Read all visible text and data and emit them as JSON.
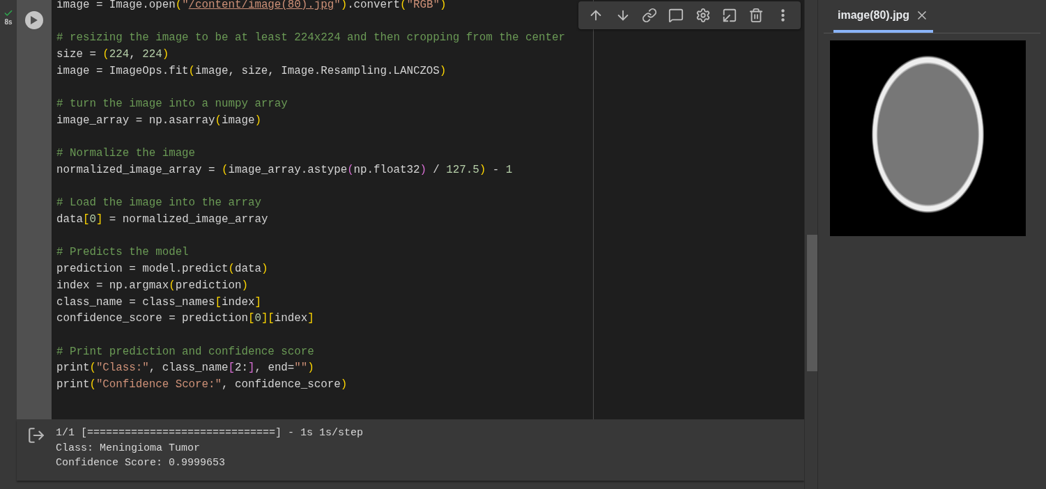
{
  "cell": {
    "status": {
      "done": true,
      "duration": "8s"
    },
    "toolbar": [
      {
        "kind": "up"
      },
      {
        "kind": "down"
      },
      {
        "kind": "link"
      },
      {
        "kind": "comment"
      },
      {
        "kind": "settings"
      },
      {
        "kind": "tab"
      },
      {
        "kind": "delete"
      },
      {
        "kind": "more"
      }
    ],
    "code_blocks": [
      [
        [
          {
            "kind": "plain",
            "text": "image = Image.open"
          },
          {
            "kind": "bracket",
            "text": "("
          },
          {
            "kind": "string",
            "text": "\""
          },
          {
            "kind": "link",
            "text": "/content/image(80).jpg"
          },
          {
            "kind": "string",
            "text": "\""
          },
          {
            "kind": "bracket",
            "text": ")"
          },
          {
            "kind": "plain",
            "text": ".convert"
          },
          {
            "kind": "bracket",
            "text": "("
          },
          {
            "kind": "string",
            "text": "\"RGB\""
          },
          {
            "kind": "bracket",
            "text": ")"
          }
        ]
      ],
      [
        [
          {
            "kind": "comment",
            "text": "# resizing the image to be at least 224x224 and then cropping from the center"
          }
        ],
        [
          {
            "kind": "plain",
            "text": "size = "
          },
          {
            "kind": "bracket",
            "text": "("
          },
          {
            "kind": "number",
            "text": "224"
          },
          {
            "kind": "plain",
            "text": ", "
          },
          {
            "kind": "number",
            "text": "224"
          },
          {
            "kind": "bracket",
            "text": ")"
          }
        ],
        [
          {
            "kind": "plain",
            "text": "image = ImageOps.fit"
          },
          {
            "kind": "bracket",
            "text": "("
          },
          {
            "kind": "plain",
            "text": "image, size, Image.Resampling.LANCZOS"
          },
          {
            "kind": "bracket",
            "text": ")"
          }
        ]
      ],
      [
        [
          {
            "kind": "comment",
            "text": "# turn the image into a numpy array"
          }
        ],
        [
          {
            "kind": "plain",
            "text": "image_array = np.asarray"
          },
          {
            "kind": "bracket",
            "text": "("
          },
          {
            "kind": "plain",
            "text": "image"
          },
          {
            "kind": "bracket",
            "text": ")"
          }
        ]
      ],
      [
        [
          {
            "kind": "comment",
            "text": "# Normalize the image"
          }
        ],
        [
          {
            "kind": "plain",
            "text": "normalized_image_array = "
          },
          {
            "kind": "bracket",
            "text": "("
          },
          {
            "kind": "plain",
            "text": "image_array.astype"
          },
          {
            "kind": "bracket2",
            "text": "("
          },
          {
            "kind": "plain",
            "text": "np.float32"
          },
          {
            "kind": "bracket2",
            "text": ")"
          },
          {
            "kind": "plain",
            "text": " / "
          },
          {
            "kind": "number",
            "text": "127.5"
          },
          {
            "kind": "bracket",
            "text": ")"
          },
          {
            "kind": "plain",
            "text": " - "
          },
          {
            "kind": "number",
            "text": "1"
          }
        ]
      ],
      [
        [
          {
            "kind": "comment",
            "text": "# Load the image into the array"
          }
        ],
        [
          {
            "kind": "plain",
            "text": "data"
          },
          {
            "kind": "bracket",
            "text": "["
          },
          {
            "kind": "number",
            "text": "0"
          },
          {
            "kind": "bracket",
            "text": "]"
          },
          {
            "kind": "plain",
            "text": " = normalized_image_array"
          }
        ]
      ],
      [
        [
          {
            "kind": "comment",
            "text": "# Predicts the model"
          }
        ],
        [
          {
            "kind": "plain",
            "text": "prediction = model.predict"
          },
          {
            "kind": "bracket",
            "text": "("
          },
          {
            "kind": "plain",
            "text": "data"
          },
          {
            "kind": "bracket",
            "text": ")"
          }
        ],
        [
          {
            "kind": "plain",
            "text": "index = np.argmax"
          },
          {
            "kind": "bracket",
            "text": "("
          },
          {
            "kind": "plain",
            "text": "prediction"
          },
          {
            "kind": "bracket",
            "text": ")"
          }
        ],
        [
          {
            "kind": "plain",
            "text": "class_name = class_names"
          },
          {
            "kind": "bracket",
            "text": "["
          },
          {
            "kind": "plain",
            "text": "index"
          },
          {
            "kind": "bracket",
            "text": "]"
          }
        ],
        [
          {
            "kind": "plain",
            "text": "confidence_score = prediction"
          },
          {
            "kind": "bracket",
            "text": "["
          },
          {
            "kind": "number",
            "text": "0"
          },
          {
            "kind": "bracket",
            "text": "]["
          },
          {
            "kind": "plain",
            "text": "index"
          },
          {
            "kind": "bracket",
            "text": "]"
          }
        ]
      ],
      [
        [
          {
            "kind": "comment",
            "text": "# Print prediction and confidence score"
          }
        ],
        [
          {
            "kind": "plain",
            "text": "print"
          },
          {
            "kind": "bracket",
            "text": "("
          },
          {
            "kind": "string",
            "text": "\"Class:\""
          },
          {
            "kind": "plain",
            "text": ", class_name"
          },
          {
            "kind": "bracket2",
            "text": "["
          },
          {
            "kind": "plain",
            "text": "2:"
          },
          {
            "kind": "bracket2",
            "text": "]"
          },
          {
            "kind": "plain",
            "text": ", end="
          },
          {
            "kind": "string",
            "text": "\"\""
          },
          {
            "kind": "bracket",
            "text": ")"
          }
        ],
        [
          {
            "kind": "plain",
            "text": "print"
          },
          {
            "kind": "bracket",
            "text": "("
          },
          {
            "kind": "string",
            "text": "\"Confidence Score:\""
          },
          {
            "kind": "plain",
            "text": ", confidence_score"
          },
          {
            "kind": "bracket",
            "text": ")"
          }
        ]
      ]
    ],
    "output": [
      "1/1 [==============================] - 1s 1s/step",
      "Class: Meningioma Tumor",
      "Confidence Score: 0.9999653"
    ]
  },
  "side_panel": {
    "tabs": [
      {
        "label": "image(80).jpg",
        "selected": true
      }
    ]
  }
}
